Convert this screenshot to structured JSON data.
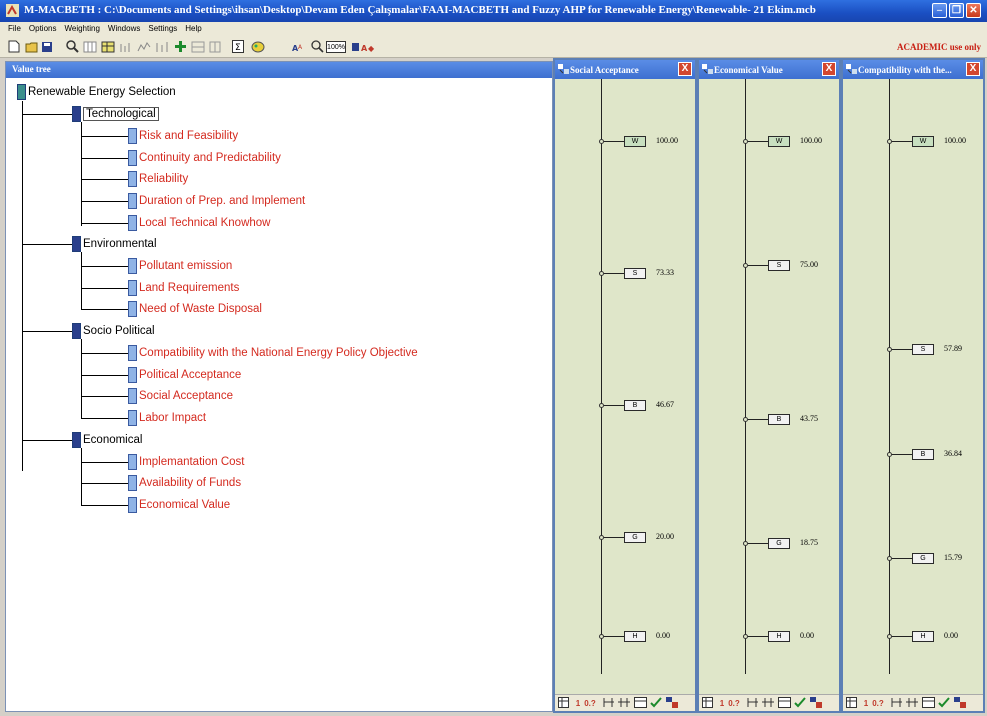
{
  "window": {
    "title": "M-MACBETH : C:\\Documents and Settings\\ihsan\\Desktop\\Devam Eden Çalışmalar\\FAAI-MACBETH and Fuzzy AHP for Renewable Energy\\Renewable- 21 Ekim.mcb",
    "controls": [
      "minimize",
      "restore",
      "close"
    ]
  },
  "menu": [
    "File",
    "Options",
    "Weighting",
    "Windows",
    "Settings",
    "Help"
  ],
  "toolbar": {
    "zoom_label": "100%",
    "academic_notice": "ACADEMIC use only"
  },
  "tree": {
    "header": "Value tree",
    "root": "Renewable Energy Selection",
    "criteria": [
      {
        "label": "Technological",
        "items": [
          "Risk and Feasibility",
          "Continuity and Predictability",
          "Reliability",
          "Duration of Prep. and Implement",
          "Local Technical Knowhow"
        ]
      },
      {
        "label": "Environmental",
        "items": [
          "Pollutant emission",
          "Land Requirements",
          "Need of Waste Disposal"
        ]
      },
      {
        "label": "Socio Political",
        "items": [
          "Compatibility with the National Energy Policy Objective",
          "Political Acceptance",
          "Social Acceptance",
          "Labor Impact"
        ]
      },
      {
        "label": "Economical",
        "items": [
          "Implemantation Cost",
          "Availability of Funds",
          "Economical Value"
        ]
      }
    ]
  },
  "scales": [
    {
      "title": "Social Acceptance",
      "close": "X",
      "levels": [
        {
          "code": "W",
          "value": "100.00",
          "fraction": 1.0
        },
        {
          "code": "S",
          "value": "73.33",
          "fraction": 0.7333
        },
        {
          "code": "B",
          "value": "46.67",
          "fraction": 0.4667
        },
        {
          "code": "G",
          "value": "20.00",
          "fraction": 0.2
        },
        {
          "code": "H",
          "value": "0.00",
          "fraction": 0.0
        }
      ]
    },
    {
      "title": "Economical Value",
      "close": "X",
      "levels": [
        {
          "code": "W",
          "value": "100.00",
          "fraction": 1.0
        },
        {
          "code": "S",
          "value": "75.00",
          "fraction": 0.75
        },
        {
          "code": "B",
          "value": "43.75",
          "fraction": 0.4375
        },
        {
          "code": "G",
          "value": "18.75",
          "fraction": 0.1875
        },
        {
          "code": "H",
          "value": "0.00",
          "fraction": 0.0
        }
      ]
    },
    {
      "title": "Compatibility with the...",
      "close": "X",
      "levels": [
        {
          "code": "W",
          "value": "100.00",
          "fraction": 1.0
        },
        {
          "code": "S",
          "value": "57.89",
          "fraction": 0.5789
        },
        {
          "code": "B",
          "value": "36.84",
          "fraction": 0.3684
        },
        {
          "code": "G",
          "value": "15.79",
          "fraction": 0.1579
        },
        {
          "code": "H",
          "value": "0.00",
          "fraction": 0.0
        }
      ]
    }
  ],
  "scale_footer": [
    "1",
    "0.?"
  ]
}
